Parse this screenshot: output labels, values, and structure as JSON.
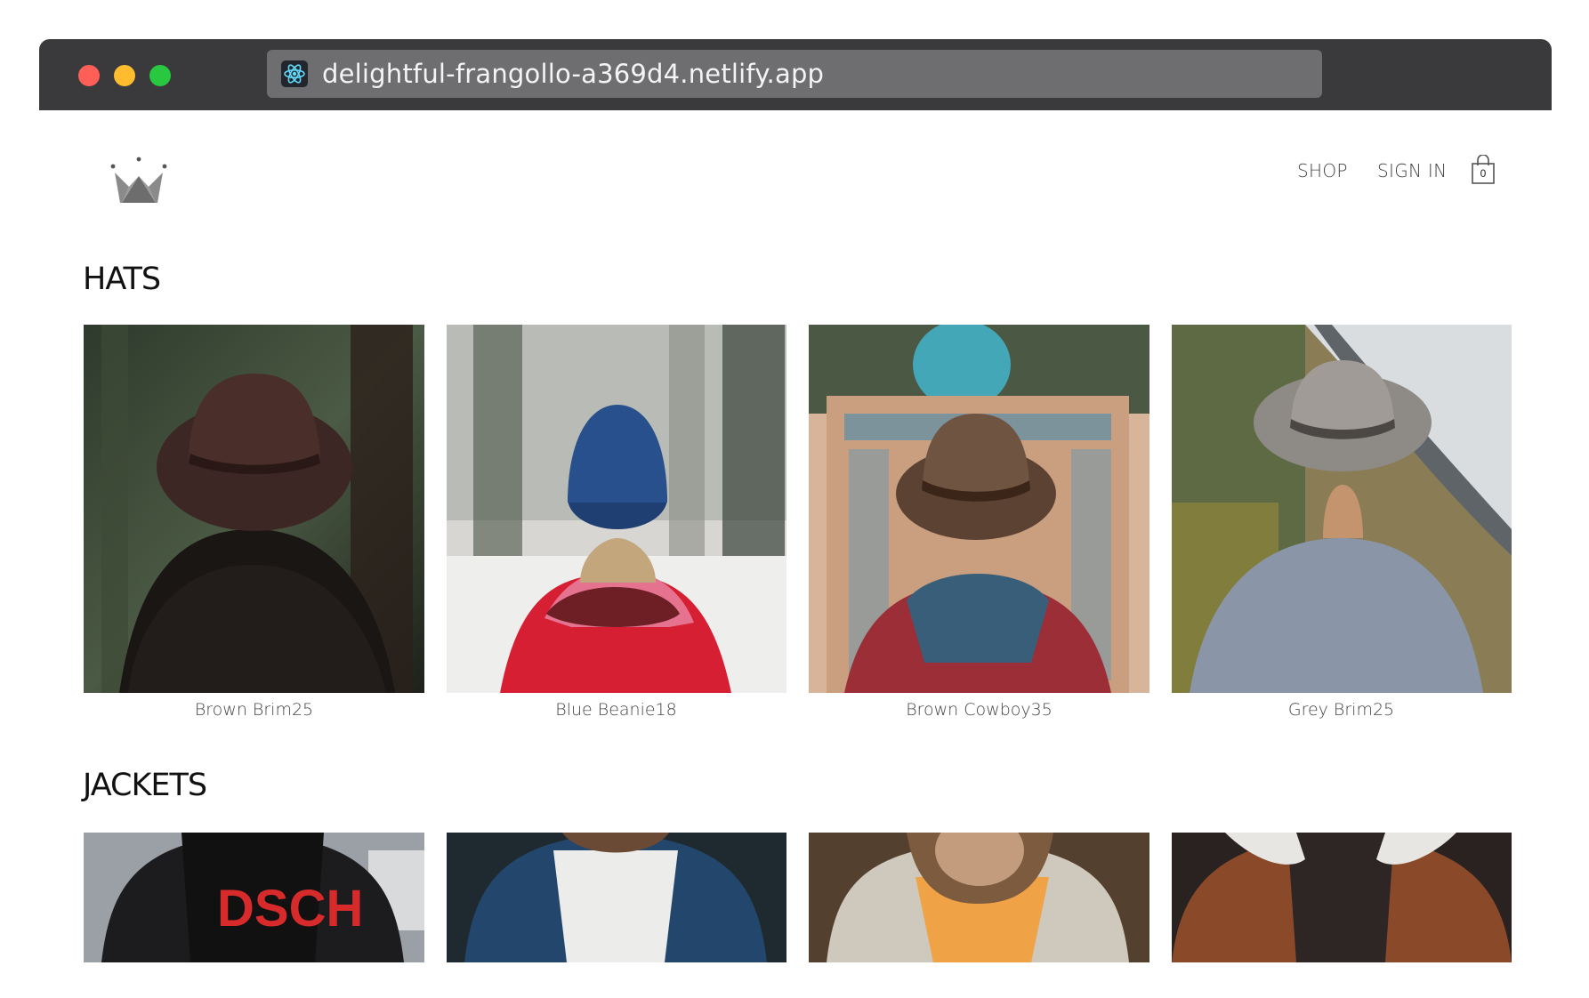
{
  "browser": {
    "url": "delightful-frangollo-a369d4.netlify.app",
    "favicon": "react-icon"
  },
  "header": {
    "logo": "crown-icon",
    "nav": {
      "shop": "SHOP",
      "sign_in": "SIGN IN"
    },
    "cart": {
      "icon": "shopping-bag-icon",
      "count": "0"
    }
  },
  "sections": {
    "hats": {
      "title": "HATS",
      "items": [
        {
          "name": "Brown Brim25"
        },
        {
          "name": "Blue Beanie18"
        },
        {
          "name": "Brown Cowboy35"
        },
        {
          "name": "Grey Brim25"
        }
      ]
    },
    "jackets": {
      "title": "JACKETS",
      "items": [
        {},
        {},
        {},
        {}
      ]
    }
  },
  "colors": {
    "chrome": "#3a3a3c",
    "url_bar": "#6e6e70",
    "close": "#ff5f57",
    "minimize": "#febc2e",
    "maximize": "#28c840",
    "text": "#444444"
  }
}
